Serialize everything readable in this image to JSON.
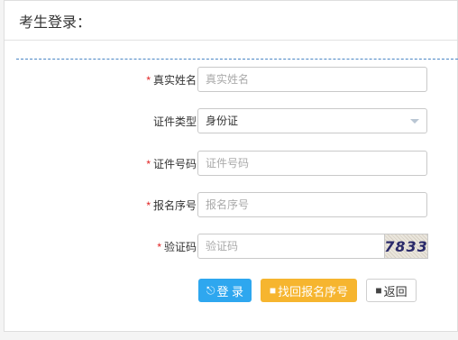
{
  "header": {
    "title": "考生登录："
  },
  "form": {
    "name": {
      "label": "真实姓名",
      "required_mark": "*",
      "placeholder": "真实姓名"
    },
    "id_type": {
      "label": "证件类型",
      "value": "身份证"
    },
    "id_number": {
      "label": "证件号码",
      "required_mark": "*",
      "placeholder": "证件号码"
    },
    "reg_number": {
      "label": "报名序号",
      "required_mark": "*",
      "placeholder": "报名序号"
    },
    "captcha": {
      "label": "验证码",
      "required_mark": "*",
      "placeholder": "验证码",
      "image_text": "7833"
    }
  },
  "buttons": {
    "login": {
      "icon": "login-icon",
      "label": "登 录"
    },
    "find": {
      "icon": "binoculars-icon",
      "label": "找回报名序号"
    },
    "back": {
      "icon": "binoculars-icon",
      "label": "返回"
    }
  },
  "colors": {
    "login": "#2ea7ef",
    "find": "#f6b52f",
    "required": "#e02020",
    "dashed": "#4a86c5"
  }
}
